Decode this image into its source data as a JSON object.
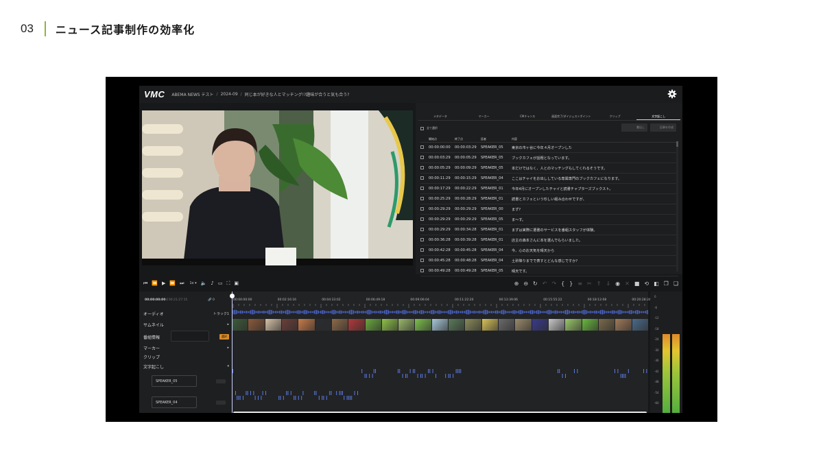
{
  "slide": {
    "number": "03",
    "title": "ニュース記事制作の効率化"
  },
  "app": {
    "logo": "VMC",
    "breadcrumbs": [
      "ABEMA NEWS テスト",
      "2024-09",
      "同じ本が好きな人とマッチング!?趣味が合うと気も合う?"
    ]
  },
  "panel": {
    "tabs": [
      "メタデータ",
      "マーカー",
      "CMチャンス",
      "画面完了/ダイジェストポイント",
      "クリップ",
      "文字起こし"
    ],
    "active_tab": "文字起こし",
    "select_all": "全て選択",
    "btn_primary": "書出し",
    "btn_secondary": "記事を作成",
    "columns": [
      "開始点",
      "終了点",
      "話者",
      "内容"
    ],
    "rows": [
      {
        "start": "00:00:00:00",
        "end": "00:00:03:29",
        "speaker": "SPEAKER_05",
        "text": "東京の市ヶ谷に今年４月オープンした"
      },
      {
        "start": "00:00:03:29",
        "end": "00:00:05:29",
        "speaker": "SPEAKER_05",
        "text": "ブックカフェが話題となっています。"
      },
      {
        "start": "00:00:05:29",
        "end": "00:00:09:29",
        "speaker": "SPEAKER_05",
        "text": "本だけではなく、人とのマッチングもしてくれるそうです。"
      },
      {
        "start": "00:00:11:29",
        "end": "00:00:15:29",
        "speaker": "SPEAKER_04",
        "text": "ここはチャイをお出ししている専属専門のブックカフェになります。"
      },
      {
        "start": "00:00:17:29",
        "end": "00:00:22:29",
        "speaker": "SPEAKER_01",
        "text": "今年4月にオープンしたチャイと読書チャプターズブックスト。"
      },
      {
        "start": "00:00:25:29",
        "end": "00:00:28:29",
        "speaker": "SPEAKER_01",
        "text": "読書とカフェという珍しい組み合わせですが、"
      },
      {
        "start": "00:00:29:29",
        "end": "00:00:29:29",
        "speaker": "SPEAKER_00",
        "text": "まず?"
      },
      {
        "start": "00:00:29:29",
        "end": "00:00:29:29",
        "speaker": "SPEAKER_05",
        "text": "ま〜す。"
      },
      {
        "start": "00:00:29:29",
        "end": "00:00:34:28",
        "speaker": "SPEAKER_01",
        "text": "まずは実際に選書のサービスを番組スタッフが体験。"
      },
      {
        "start": "00:00:36:28",
        "end": "00:00:39:28",
        "speaker": "SPEAKER_01",
        "text": "店主の森本さんに本を選んでもらいました。"
      },
      {
        "start": "00:00:42:28",
        "end": "00:00:45:28",
        "speaker": "SPEAKER_04",
        "text": "今、心のお天気を晴天から"
      },
      {
        "start": "00:00:45:28",
        "end": "00:00:48:28",
        "speaker": "SPEAKER_04",
        "text": "土砂降りまでで表すとどんな感じですか?"
      },
      {
        "start": "00:00:49:28",
        "end": "00:00:49:28",
        "speaker": "SPEAKER_05",
        "text": "晴天です。"
      }
    ]
  },
  "player": {
    "speed": "1x"
  },
  "timeline": {
    "time_current": "00:00:00:00",
    "time_total": "00:21:27:15",
    "link_count": "0",
    "tracks": {
      "audio": "オーディオ",
      "audio_side": "トラック1",
      "thumbnail": "サムネイル",
      "program_info": "番組情報",
      "program_badge": "選択",
      "marker": "マーカー",
      "clip": "クリップ",
      "transcription": "文字起こし"
    },
    "speakers": [
      "SPEAKER_05",
      "SPEAKER_04"
    ],
    "ruler": [
      "00:00:00:00",
      "00:02:16:16",
      "00:04:33:02",
      "00:06:49:18",
      "00:09:06:04",
      "00:11:22:20",
      "00:13:39:06",
      "00:15:55:22",
      "00:18:12:08",
      "00:20:28:24"
    ],
    "thumb_colors": [
      "#3d5c3a",
      "#8a5a3c",
      "#d6c2a8",
      "#6a3f3a",
      "#c87b4a",
      "#2a2c30",
      "#8c6a4a",
      "#b03a3a",
      "#6aa83f",
      "#8fc24a",
      "#9ab86a",
      "#7ec04e",
      "#a8c8d8",
      "#5a7a5a",
      "#8a8a5a",
      "#d8c25a",
      "#6a6a6a",
      "#9a8a6a",
      "#3a3a8a",
      "#c8c8c8",
      "#9ac86a",
      "#6ab83f",
      "#7a6a4a",
      "#a07a5a",
      "#4a6a8a"
    ]
  },
  "meter": {
    "labels": [
      "0",
      "-6",
      "-12",
      "-18",
      "-24",
      "-30",
      "-36",
      "-42",
      "-48",
      "-54",
      "-60"
    ]
  }
}
